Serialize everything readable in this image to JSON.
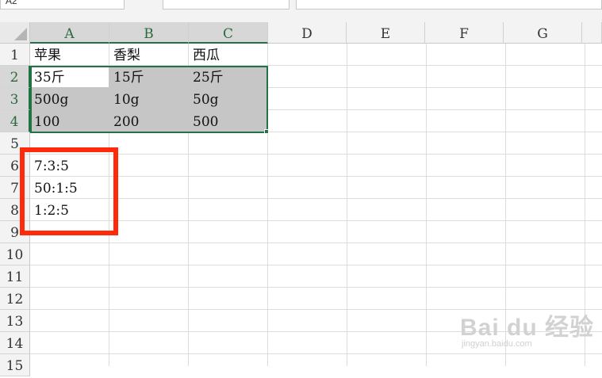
{
  "namebox": {
    "value": "A2"
  },
  "columns": [
    "A",
    "B",
    "C",
    "D",
    "E",
    "F",
    "G"
  ],
  "selected_columns": [
    "A",
    "B",
    "C"
  ],
  "rows": [
    "1",
    "2",
    "3",
    "4",
    "5",
    "6",
    "7",
    "8",
    "9",
    "10",
    "11",
    "12",
    "13",
    "14",
    "15"
  ],
  "selected_rows": [
    "2",
    "3",
    "4"
  ],
  "cells": {
    "A1": "苹果",
    "B1": "香梨",
    "C1": "西瓜",
    "A2": "35斤",
    "B2": "15斤",
    "C2": "25斤",
    "A3": "500g",
    "B3": "10g",
    "C3": "50g",
    "A4": "100",
    "B4": "200",
    "C4": "500",
    "A6": "7:3:5",
    "A7": "50:1:5",
    "A8": "1:2:5"
  },
  "colors": {
    "selection": "#217346",
    "highlight_box": "#ff2a0a",
    "selected_fill": "#c6c6c6"
  },
  "watermark": {
    "brand": "Bai du 经验",
    "url": "jingyan.baidu.com"
  }
}
